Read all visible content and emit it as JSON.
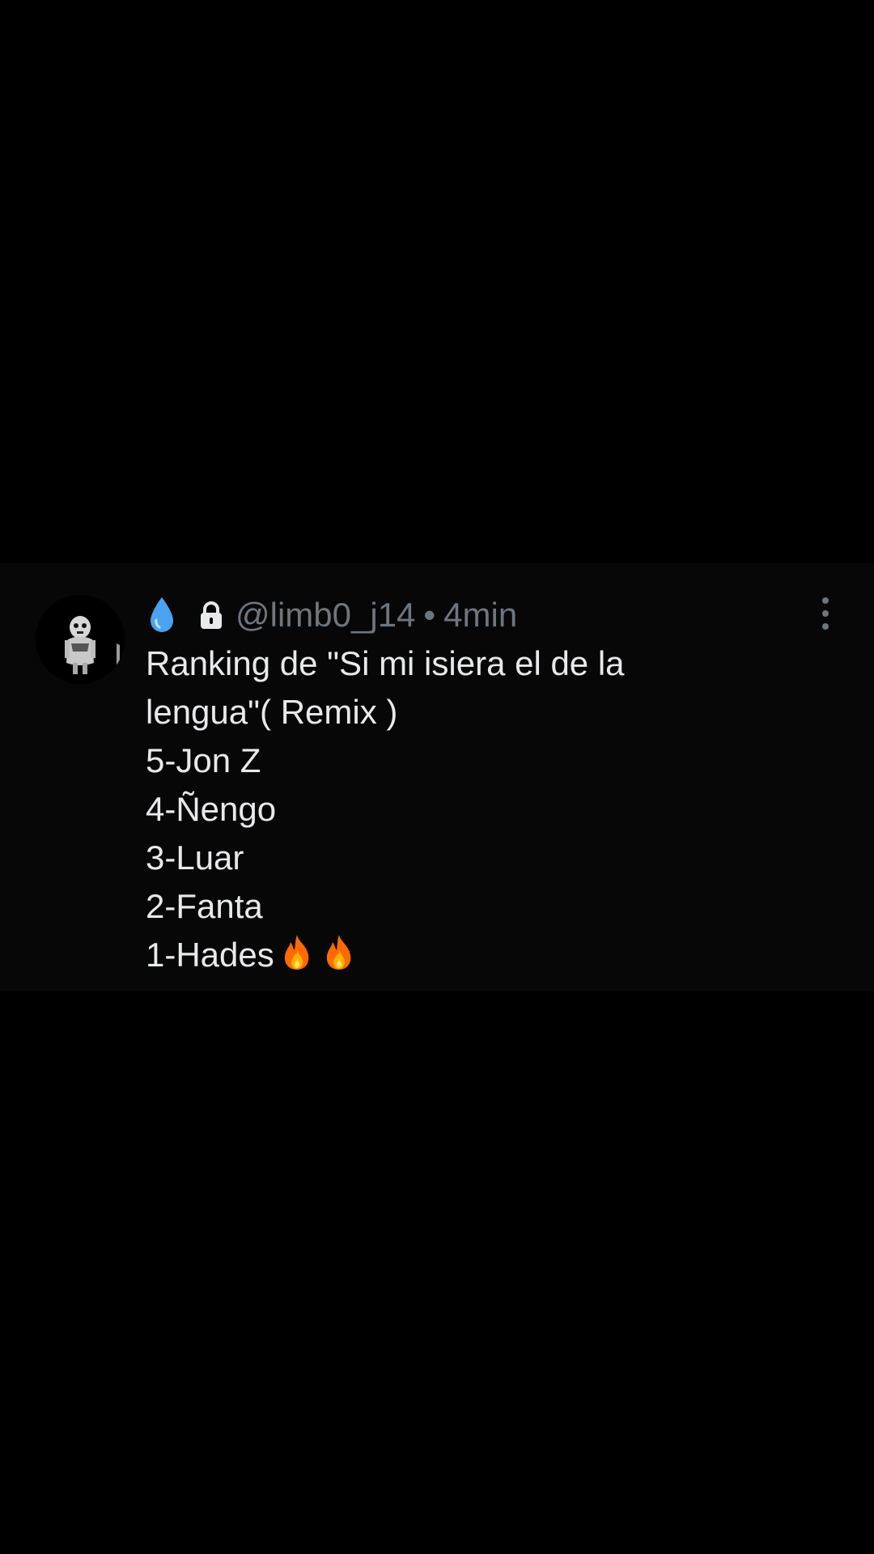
{
  "post": {
    "handle": "@limb0_j14",
    "separator": "•",
    "time": "4min",
    "text_lines": [
      "Ranking de \"Si mi isiera el de la",
      "lengua\"( Remix )",
      "5-Jon Z",
      "4-Ñengo",
      "3-Luar",
      "2-Fanta",
      "1-Hades"
    ],
    "icons": {
      "name_emoji": "droplet-icon",
      "lock": "lock-icon",
      "menu": "more-options-icon",
      "trailing_emoji": [
        "fire-icon",
        "fire-icon"
      ]
    }
  },
  "colors": {
    "background": "#000000",
    "card": "#070708",
    "text": "#e7e9ea",
    "muted": "#6e767d",
    "droplet": "#4aa3f0",
    "fire": "#ff6a00"
  }
}
